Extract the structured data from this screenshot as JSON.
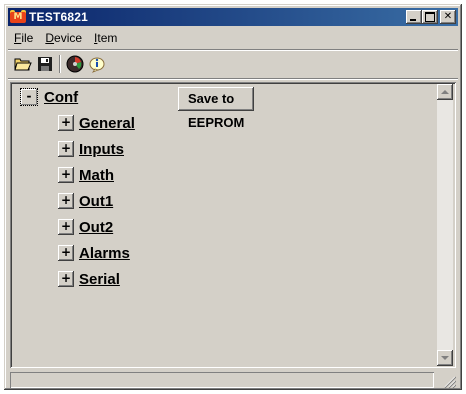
{
  "window": {
    "title": "TEST6821",
    "app_icon_text": "M",
    "caption_buttons": [
      "minimize",
      "maximize",
      "close"
    ],
    "title_gradient": [
      "#0a246a",
      "#3a6ea5"
    ]
  },
  "menu": {
    "items": [
      {
        "prefix": "",
        "underline": "F",
        "rest": "ile"
      },
      {
        "prefix": "",
        "underline": "D",
        "rest": "evice"
      },
      {
        "prefix": "",
        "underline": "I",
        "rest": "tem"
      }
    ]
  },
  "toolbar": {
    "icons": [
      "open-folder-icon",
      "save-disk-icon",
      "gauge-icon",
      "info-icon"
    ]
  },
  "tree": {
    "root": {
      "label": "Conf",
      "expander": "-"
    },
    "save_button": "Save to EEPROM",
    "children": [
      {
        "label": "General",
        "expander": "+"
      },
      {
        "label": "Inputs",
        "expander": "+"
      },
      {
        "label": "Math",
        "expander": "+"
      },
      {
        "label": "Out1",
        "expander": "+"
      },
      {
        "label": "Out2",
        "expander": "+"
      },
      {
        "label": "Alarms",
        "expander": "+"
      },
      {
        "label": "Serial",
        "expander": "+"
      }
    ]
  },
  "statusbar": {
    "text": ""
  }
}
